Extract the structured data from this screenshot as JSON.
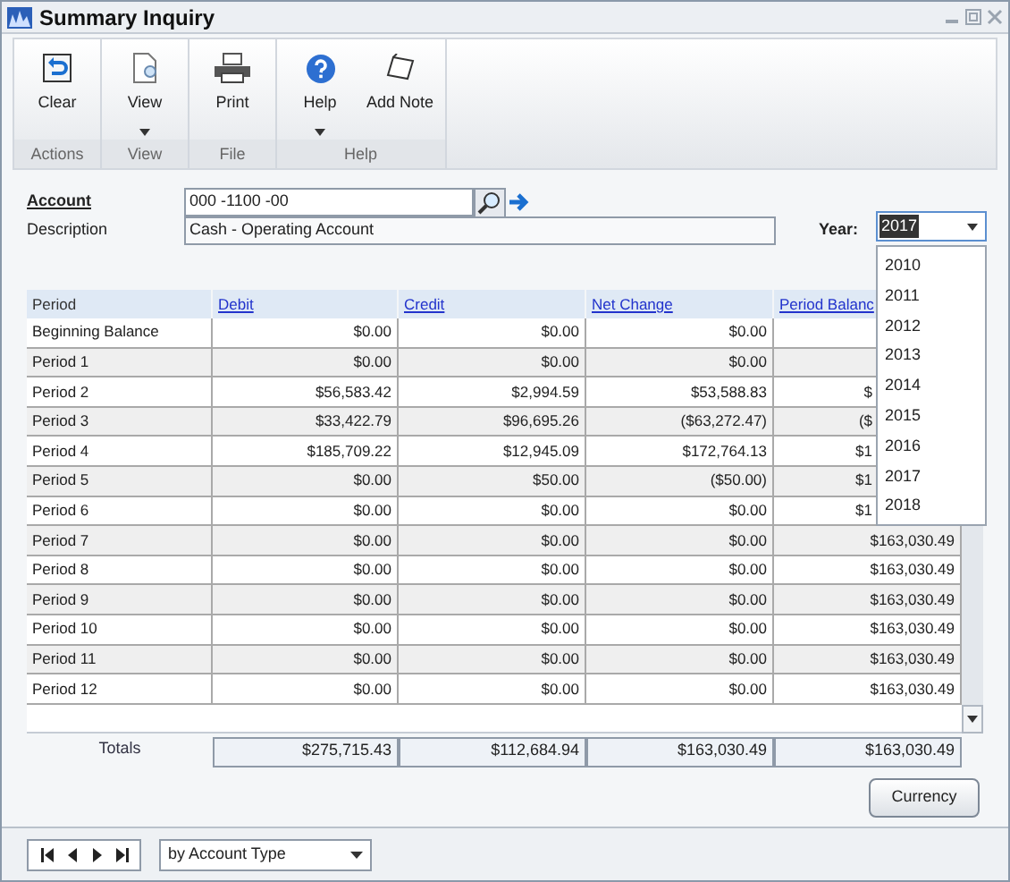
{
  "window": {
    "title": "Summary Inquiry"
  },
  "ribbon": {
    "groups": [
      {
        "label": "Actions",
        "buttons": [
          {
            "label": "Clear",
            "dropdown": false
          }
        ]
      },
      {
        "label": "View",
        "buttons": [
          {
            "label": "View",
            "dropdown": true
          }
        ]
      },
      {
        "label": "File",
        "buttons": [
          {
            "label": "Print",
            "dropdown": false
          }
        ]
      },
      {
        "label": "Help",
        "buttons": [
          {
            "label": "Help",
            "dropdown": true
          },
          {
            "label": "Add Note",
            "dropdown": false
          }
        ]
      }
    ]
  },
  "account": {
    "label": "Account",
    "value": "000  -1100  -00"
  },
  "description": {
    "label": "Description",
    "value": "Cash - Operating Account"
  },
  "year": {
    "label": "Year:",
    "value": "2017",
    "open": true,
    "options": [
      "2010",
      "2011",
      "2012",
      "2013",
      "2014",
      "2015",
      "2016",
      "2017",
      "2018"
    ]
  },
  "table": {
    "columns": [
      "Period",
      "Debit",
      "Credit",
      "Net Change",
      "Period Balanc"
    ],
    "rows": [
      [
        "Beginning Balance",
        "$0.00",
        "$0.00",
        "$0.00",
        null
      ],
      [
        "Period 1",
        "$0.00",
        "$0.00",
        "$0.00",
        null
      ],
      [
        "Period 2",
        "$56,583.42",
        "$2,994.59",
        "$53,588.83",
        "$"
      ],
      [
        "Period 3",
        "$33,422.79",
        "$96,695.26",
        "($63,272.47)",
        "($"
      ],
      [
        "Period 4",
        "$185,709.22",
        "$12,945.09",
        "$172,764.13",
        "$1"
      ],
      [
        "Period 5",
        "$0.00",
        "$50.00",
        "($50.00)",
        "$1"
      ],
      [
        "Period 6",
        "$0.00",
        "$0.00",
        "$0.00",
        "$1"
      ],
      [
        "Period 7",
        "$0.00",
        "$0.00",
        "$0.00",
        "$163,030.49"
      ],
      [
        "Period 8",
        "$0.00",
        "$0.00",
        "$0.00",
        "$163,030.49"
      ],
      [
        "Period 9",
        "$0.00",
        "$0.00",
        "$0.00",
        "$163,030.49"
      ],
      [
        "Period 10",
        "$0.00",
        "$0.00",
        "$0.00",
        "$163,030.49"
      ],
      [
        "Period 11",
        "$0.00",
        "$0.00",
        "$0.00",
        "$163,030.49"
      ],
      [
        "Period 12",
        "$0.00",
        "$0.00",
        "$0.00",
        "$163,030.49"
      ]
    ],
    "totals": {
      "label": "Totals",
      "values": [
        "$275,715.43",
        "$112,684.94",
        "$163,030.49",
        "$163,030.49"
      ]
    }
  },
  "currency_button": "Currency",
  "sort": {
    "value": "by Account Type"
  }
}
